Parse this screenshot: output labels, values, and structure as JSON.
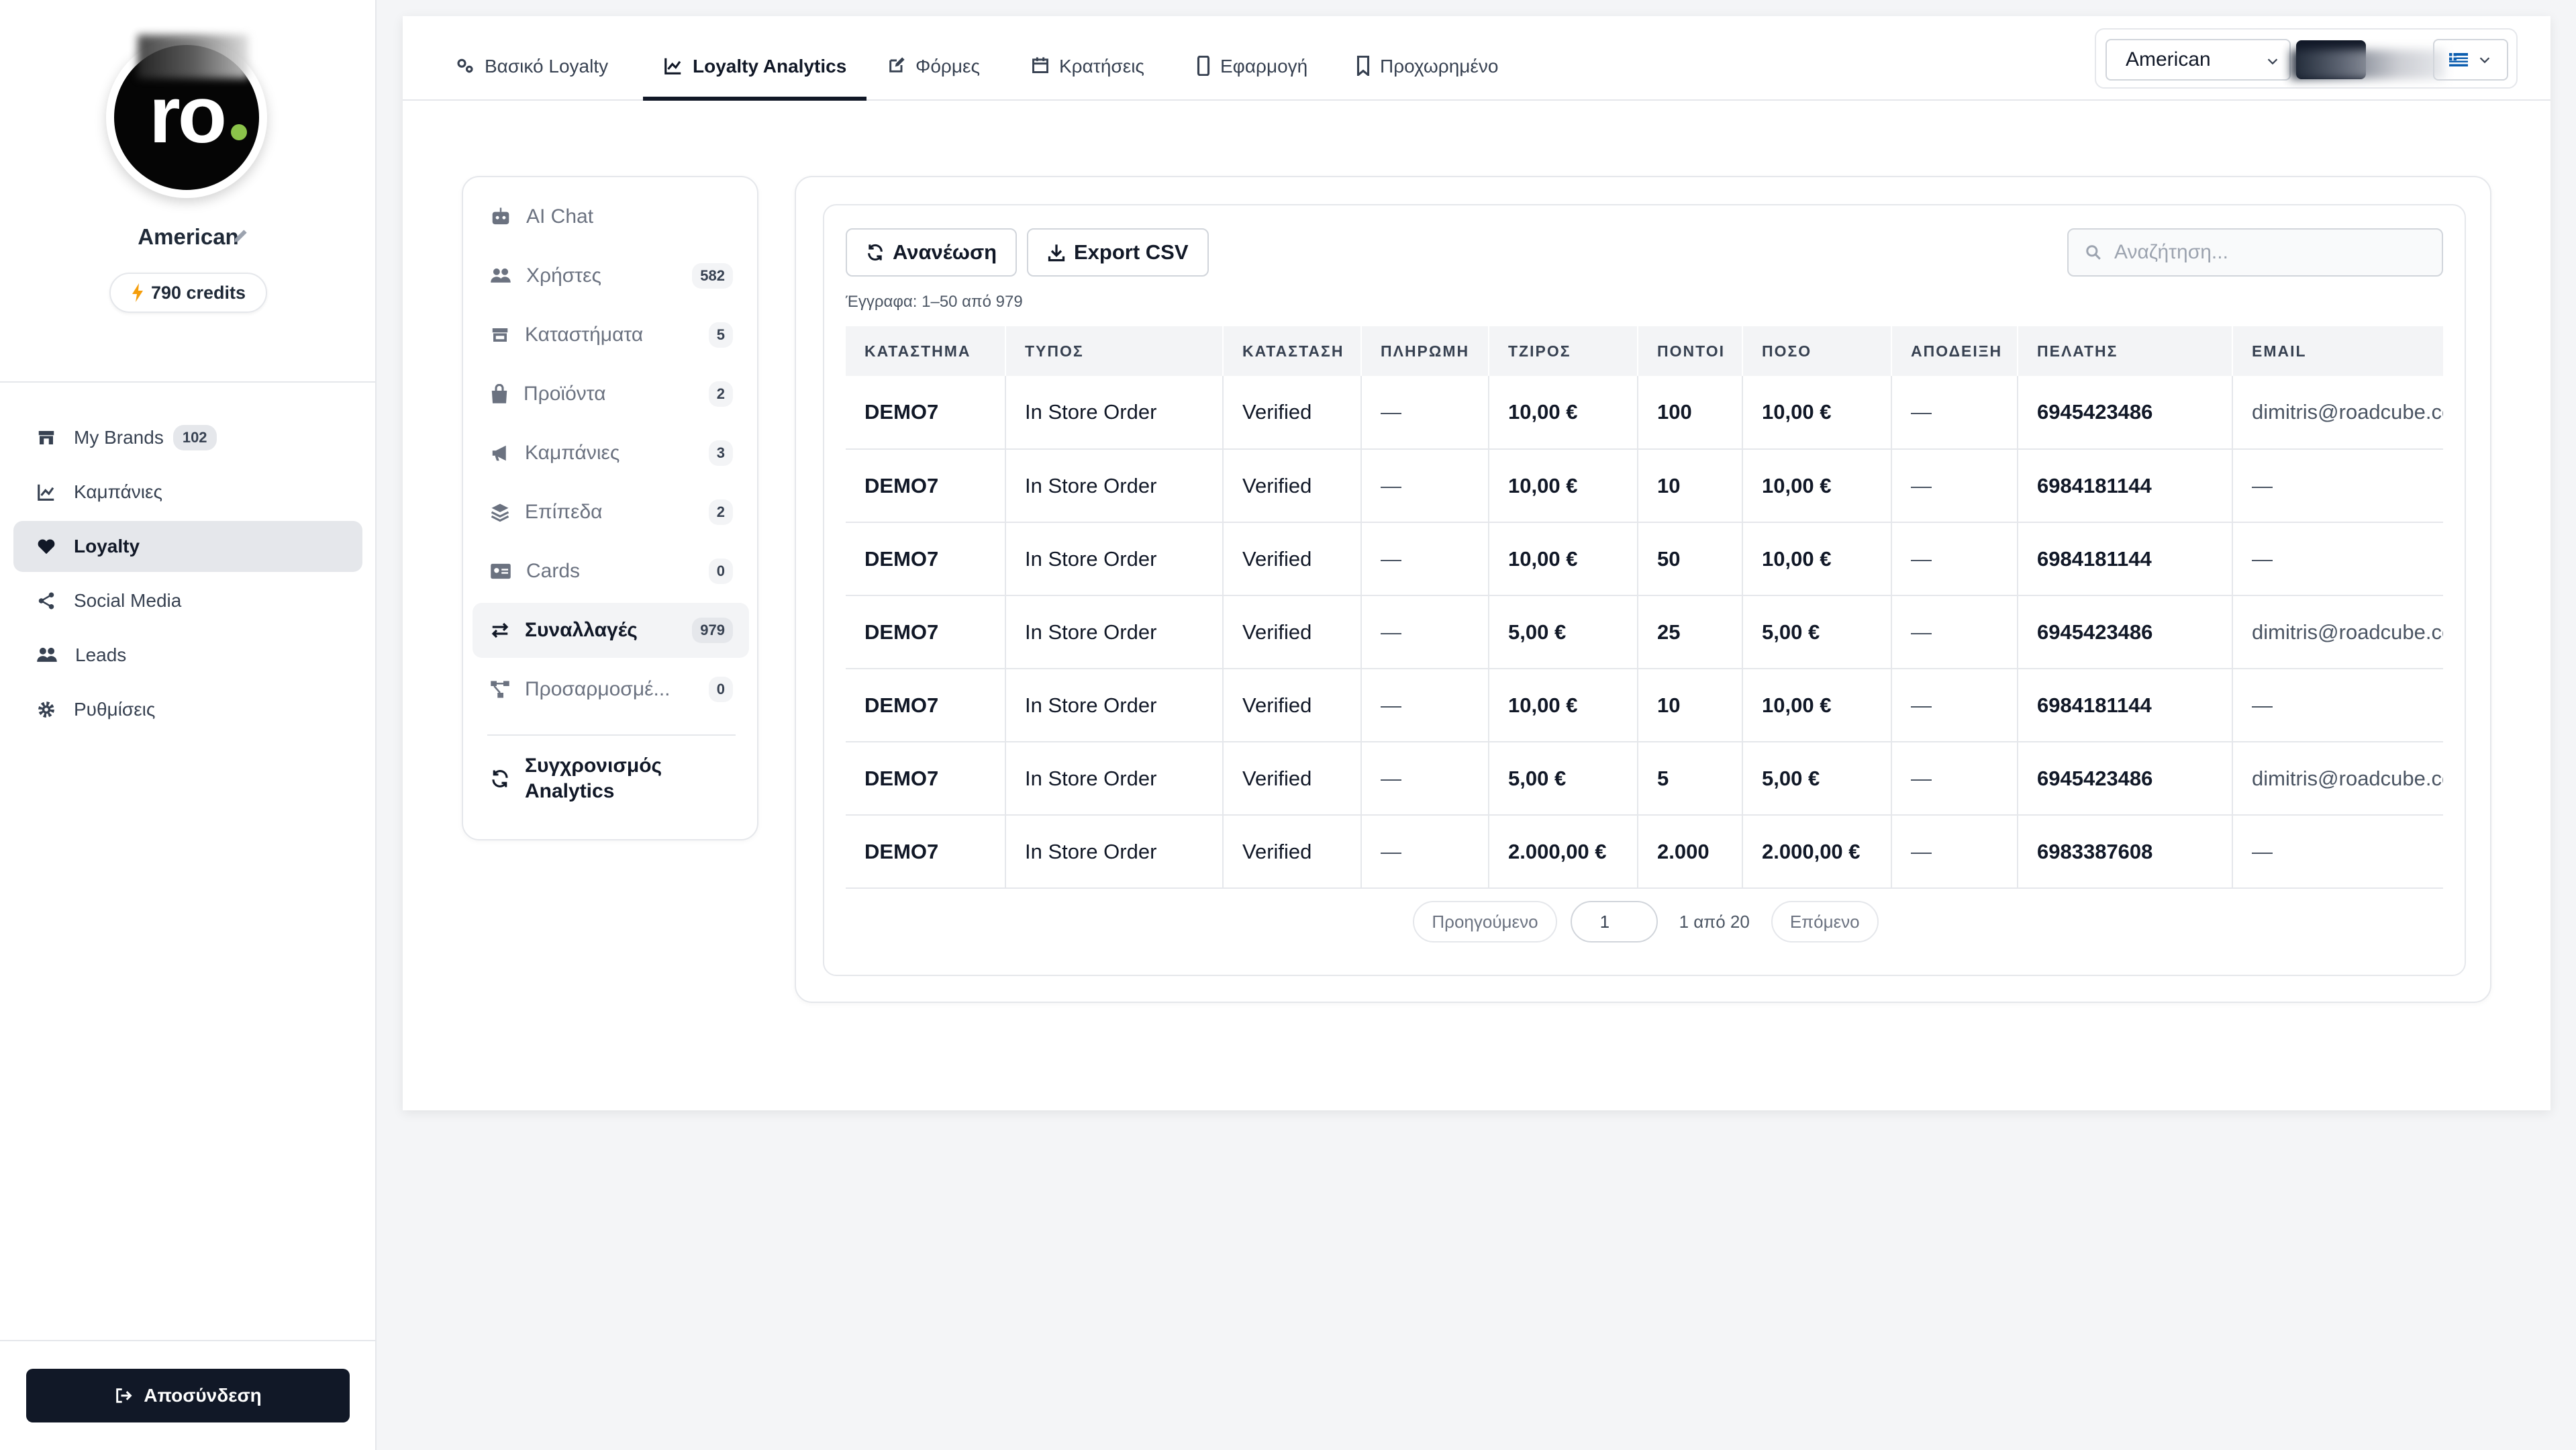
{
  "sidebar": {
    "avatar_text": "ro",
    "brand_name": "American",
    "credits": "790 credits",
    "nav": [
      {
        "label": "My Brands",
        "badge": "102",
        "icon": "store-icon"
      },
      {
        "label": "Καμπάνιες",
        "icon": "chart-line-icon"
      },
      {
        "label": "Loyalty",
        "icon": "heart-icon",
        "active": true
      },
      {
        "label": "Social Media",
        "icon": "share-icon"
      },
      {
        "label": "Leads",
        "icon": "users-icon"
      },
      {
        "label": "Ρυθμίσεις",
        "icon": "gear-icon"
      }
    ],
    "logout_label": "Αποσύνδεση"
  },
  "tabs": [
    {
      "label": "Βασικό Loyalty",
      "icon": "cogs-icon"
    },
    {
      "label": "Loyalty Analytics",
      "icon": "chart-line-icon",
      "active": true
    },
    {
      "label": "Φόρμες",
      "icon": "edit-icon"
    },
    {
      "label": "Κρατήσεις",
      "icon": "calendar-icon"
    },
    {
      "label": "Εφαρμογή",
      "icon": "mobile-icon"
    },
    {
      "label": "Προχωρημένο",
      "icon": "bookmark-icon"
    }
  ],
  "top_controls": {
    "brand_select": "American"
  },
  "subnav": {
    "items": [
      {
        "label": "AI Chat",
        "badge": "",
        "icon": "robot-icon"
      },
      {
        "label": "Χρήστες",
        "badge": "582",
        "icon": "users-icon"
      },
      {
        "label": "Καταστήματα",
        "badge": "5",
        "icon": "store-icon"
      },
      {
        "label": "Προϊόντα",
        "badge": "2",
        "icon": "bag-icon"
      },
      {
        "label": "Καμπάνιες",
        "badge": "3",
        "icon": "megaphone-icon"
      },
      {
        "label": "Επίπεδα",
        "badge": "2",
        "icon": "layers-icon"
      },
      {
        "label": "Cards",
        "badge": "0",
        "icon": "id-card-icon"
      },
      {
        "label": "Συναλλαγές",
        "badge": "979",
        "icon": "exchange-icon",
        "active": true
      },
      {
        "label": "Προσαρμοσμέ...",
        "badge": "0",
        "icon": "project-diagram-icon"
      }
    ],
    "sync_label_1": "Συγχρονισμός",
    "sync_label_2": "Analytics"
  },
  "toolbar": {
    "refresh_label": "Ανανέωση",
    "export_label": "Export CSV",
    "search_placeholder": "Αναζήτηση...",
    "records_text": "Έγγραφα: 1–50 από 979"
  },
  "table": {
    "columns": [
      "ΚΑΤΑΣΤΗΜΑ",
      "ΤΥΠΟΣ",
      "ΚΑΤΑΣΤΑΣΗ",
      "ΠΛΗΡΩΜΗ",
      "ΤΖΙΡΟΣ",
      "ΠΟΝΤΟΙ",
      "ΠΟΣΟ",
      "ΑΠΟΔΕΙΞΗ",
      "ΠΕΛΑΤΗΣ",
      "EMAIL"
    ],
    "rows": [
      [
        "DEMO7",
        "In Store Order",
        "Verified",
        "—",
        "10,00 €",
        "100",
        "10,00 €",
        "—",
        "6945423486",
        "dimitris@roadcube.com"
      ],
      [
        "DEMO7",
        "In Store Order",
        "Verified",
        "—",
        "10,00 €",
        "10",
        "10,00 €",
        "—",
        "6984181144",
        "—"
      ],
      [
        "DEMO7",
        "In Store Order",
        "Verified",
        "—",
        "10,00 €",
        "50",
        "10,00 €",
        "—",
        "6984181144",
        "—"
      ],
      [
        "DEMO7",
        "In Store Order",
        "Verified",
        "—",
        "5,00 €",
        "25",
        "5,00 €",
        "—",
        "6945423486",
        "dimitris@roadcube.com"
      ],
      [
        "DEMO7",
        "In Store Order",
        "Verified",
        "—",
        "10,00 €",
        "10",
        "10,00 €",
        "—",
        "6984181144",
        "—"
      ],
      [
        "DEMO7",
        "In Store Order",
        "Verified",
        "—",
        "5,00 €",
        "5",
        "5,00 €",
        "—",
        "6945423486",
        "dimitris@roadcube.com"
      ],
      [
        "DEMO7",
        "In Store Order",
        "Verified",
        "—",
        "2.000,00 €",
        "2.000",
        "2.000,00 €",
        "—",
        "6983387608",
        "—"
      ]
    ]
  },
  "pager": {
    "prev_label": "Προηγούμενο",
    "page_value": "1",
    "page_info": "1 από 20",
    "next_label": "Επόμενο"
  },
  "colors": {
    "accent": "#111827",
    "active_bg": "#e5e7eb",
    "lightning": "#f59e0b",
    "avatar_dot": "#8bc34a"
  }
}
